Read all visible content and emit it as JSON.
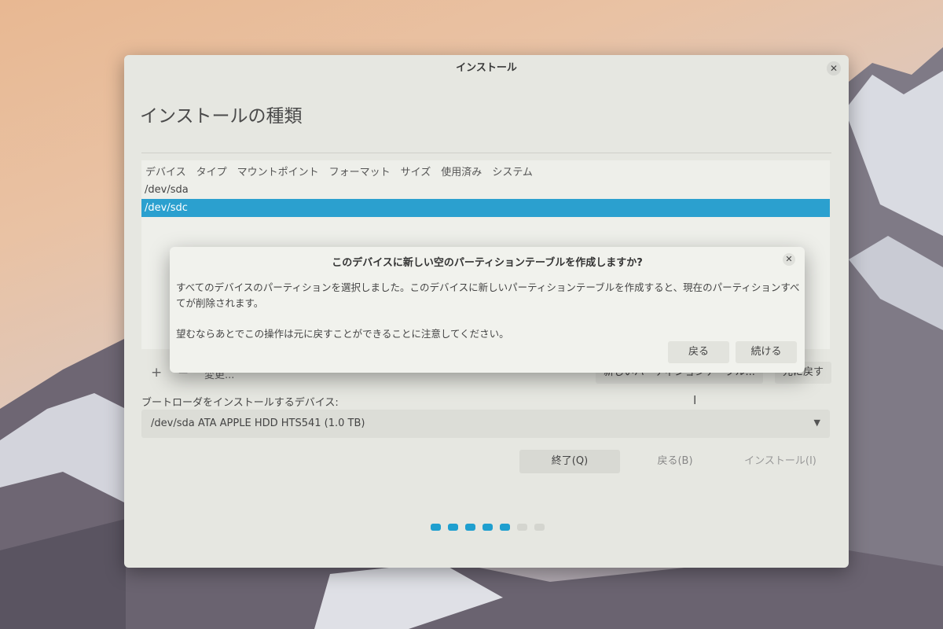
{
  "window": {
    "title": "インストール",
    "page_title": "インストールの種類"
  },
  "partition_table": {
    "columns": [
      "デバイス",
      "タイプ",
      "マウントポイント",
      "フォーマット",
      "サイズ",
      "使用済み",
      "システム"
    ],
    "rows": [
      {
        "device": "/dev/sda",
        "selected": false
      },
      {
        "device": "/dev/sdc",
        "selected": true
      }
    ]
  },
  "toolbar": {
    "add_icon": "plus-icon",
    "remove_icon": "minus-icon",
    "change_label": "変更...",
    "new_table_label": "新しいパーティションテーブル...",
    "revert_label": "元に戻す"
  },
  "bootloader": {
    "label": "ブートローダをインストールするデバイス:",
    "selected": "/dev/sda ATA APPLE HDD HTS541 (1.0 TB)"
  },
  "nav": {
    "quit": "終了(Q)",
    "back": "戻る(B)",
    "install": "インストール(I)"
  },
  "progress": {
    "total_steps": 7,
    "completed_steps": 5,
    "active_color": "#1f9fcf",
    "inactive_color": "#d4d5cf"
  },
  "dialog": {
    "title": "このデバイスに新しい空のパーティションテーブルを作成しますか?",
    "body": "すべてのデバイスのパーティションを選択しました。このデバイスに新しいパーティションテーブルを作成すると、現在のパーティションすべてが削除されます。",
    "note": "望むならあとでこの操作は元に戻すことができることに注意してください。",
    "back_button": "戻る",
    "continue_button": "続ける"
  }
}
